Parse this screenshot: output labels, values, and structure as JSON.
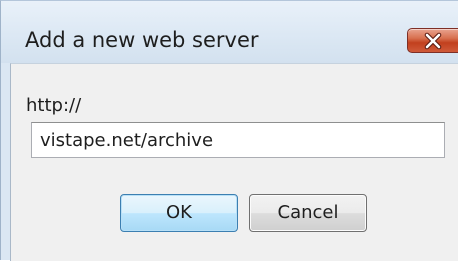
{
  "dialog": {
    "title": "Add a new web server",
    "close_icon": "close-x-icon",
    "url_label": "http://",
    "url_value": "vistape.net/archive",
    "ok_label": "OK",
    "cancel_label": "Cancel"
  },
  "colors": {
    "title_bar": "#dce8f4",
    "client_area": "#f0f0f0",
    "close_button": "#c2401e",
    "default_button_border": "#3c7fb1"
  }
}
